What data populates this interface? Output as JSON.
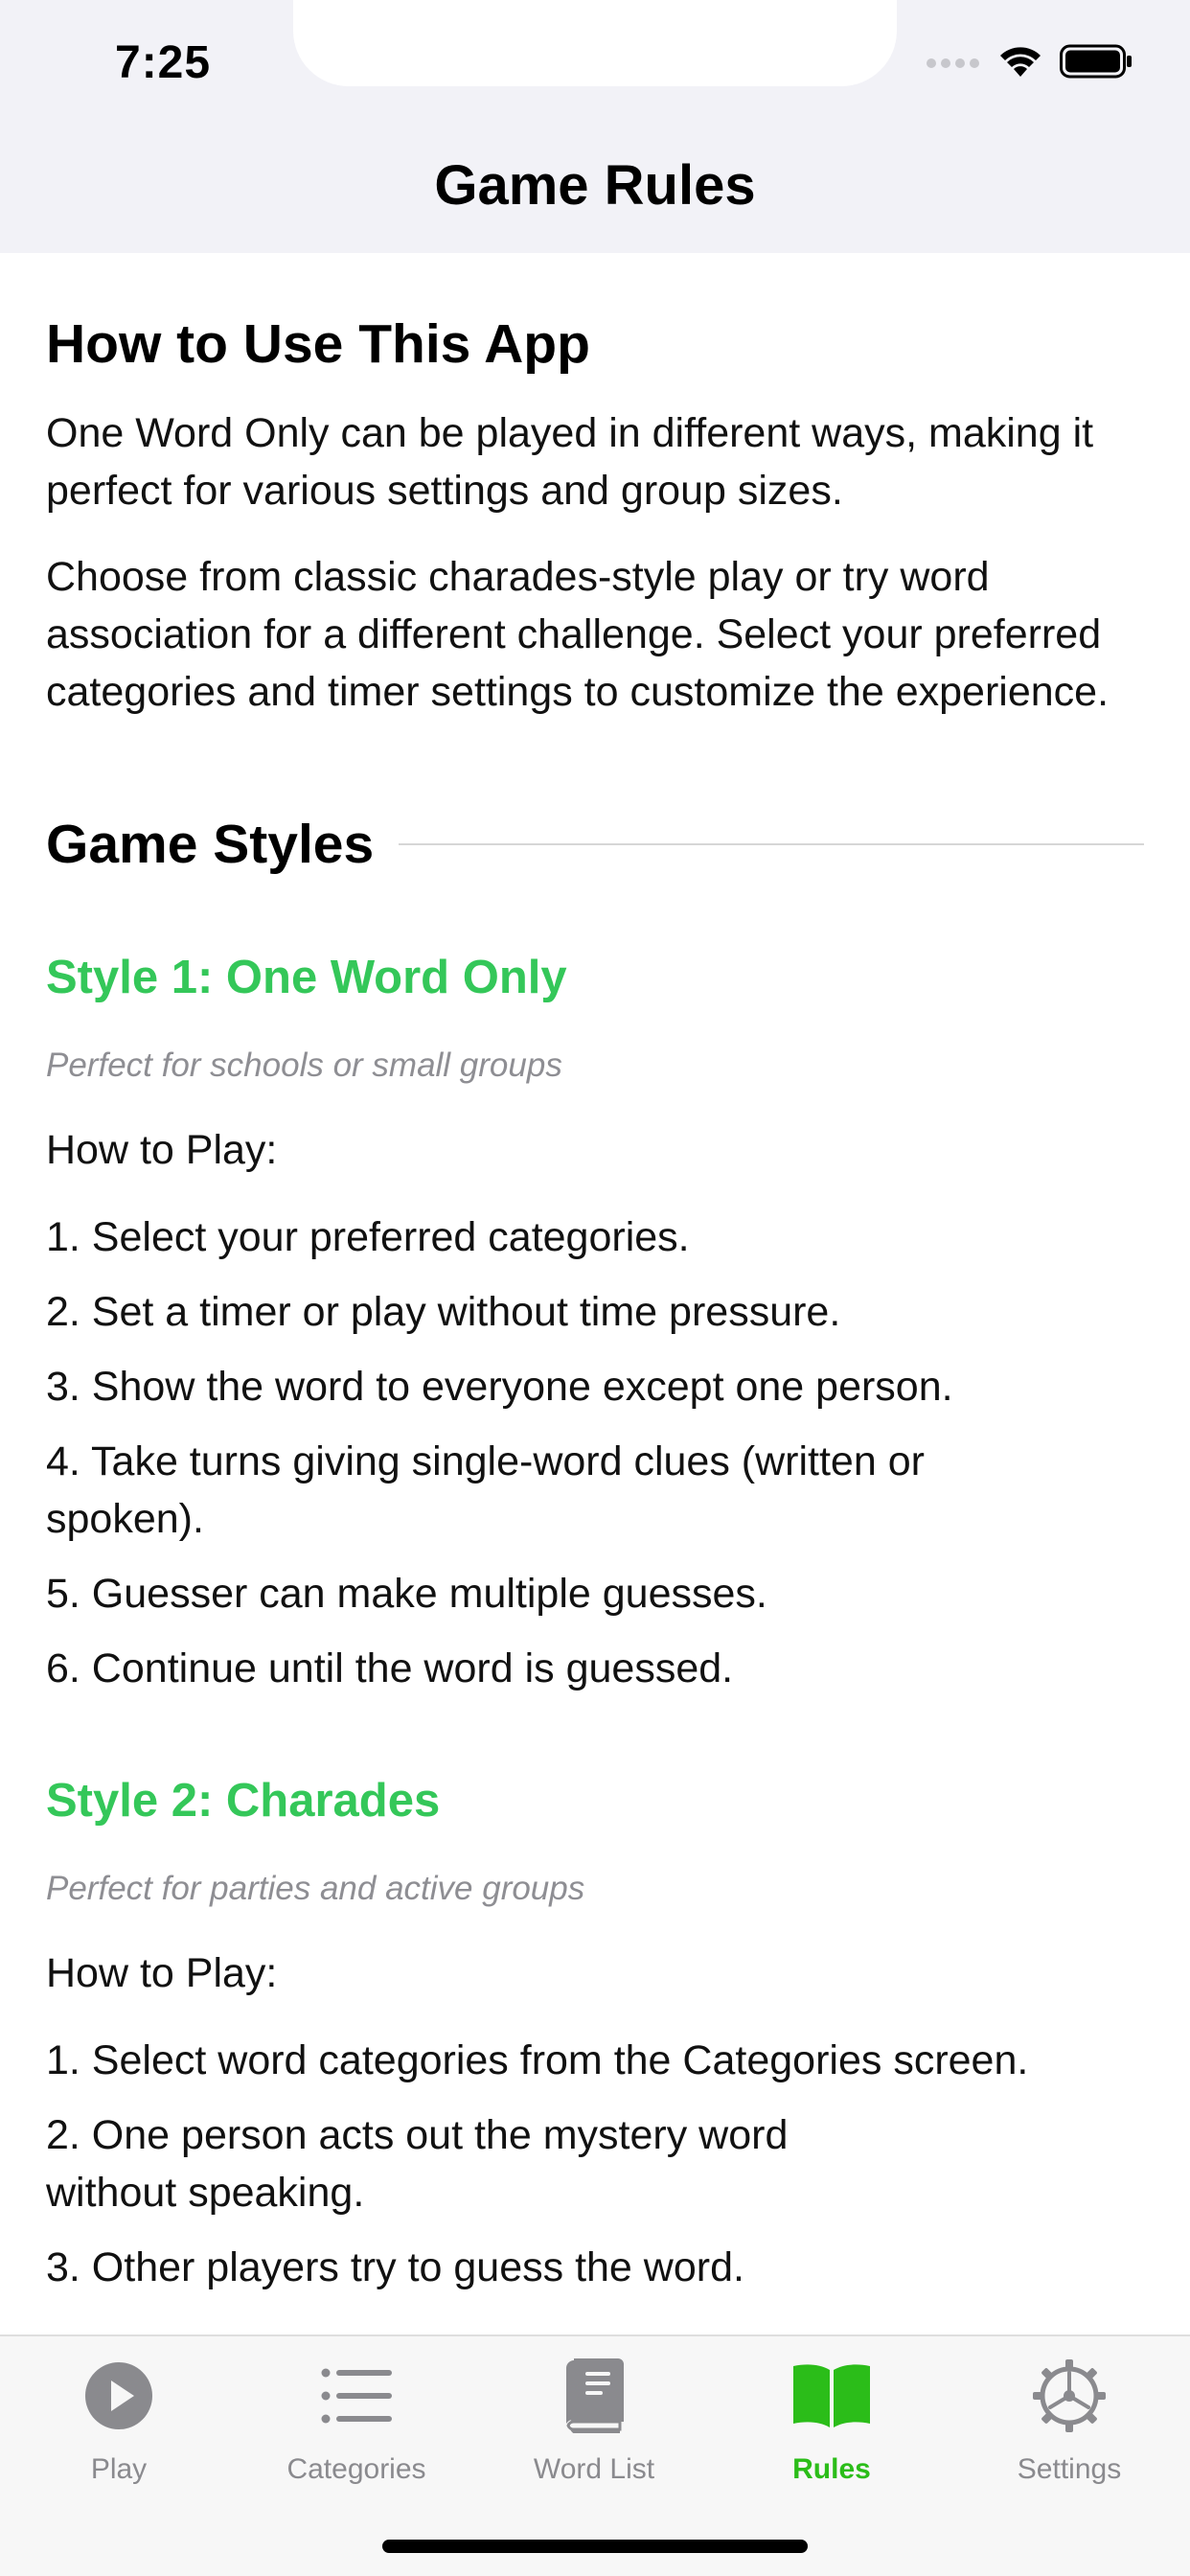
{
  "status_bar": {
    "time": "7:25"
  },
  "nav": {
    "title": "Game Rules"
  },
  "intro": {
    "heading": "How to Use This App",
    "paragraph1": "One Word Only can be played in different ways, making it perfect for various settings and group sizes.",
    "paragraph2": "Choose from classic charades-style play or try word association for a different challenge. Select your preferred categories and timer settings to customize the experience."
  },
  "game_styles": {
    "heading": "Game Styles",
    "styles": [
      {
        "title": "Style 1: One Word Only",
        "subtitle": "Perfect for schools or small groups",
        "how_to_label": "How to Play:",
        "steps": [
          "1. Select your preferred categories.",
          "2. Set a timer or play without time pressure.",
          "3. Show the word to everyone except one person.",
          "4. Take turns giving single-word clues (written or spoken).",
          "5. Guesser can make multiple guesses.",
          "6. Continue until the word is guessed."
        ]
      },
      {
        "title": "Style 2: Charades",
        "subtitle": "Perfect for parties and active groups",
        "how_to_label": "How to Play:",
        "steps": [
          "1. Select word categories from the Categories screen.",
          "2. One person acts out the mystery word without speaking.",
          "3. Other players try to guess the word."
        ]
      }
    ]
  },
  "tab_bar": {
    "active_color": "#2bbd19",
    "inactive_color": "#8a8a8e",
    "tabs": [
      {
        "label": "Play",
        "icon": "play-circle-icon",
        "active": false
      },
      {
        "label": "Categories",
        "icon": "list-icon",
        "active": false
      },
      {
        "label": "Word List",
        "icon": "book-icon",
        "active": false
      },
      {
        "label": "Rules",
        "icon": "open-book-icon",
        "active": true
      },
      {
        "label": "Settings",
        "icon": "gear-icon",
        "active": false
      }
    ]
  }
}
